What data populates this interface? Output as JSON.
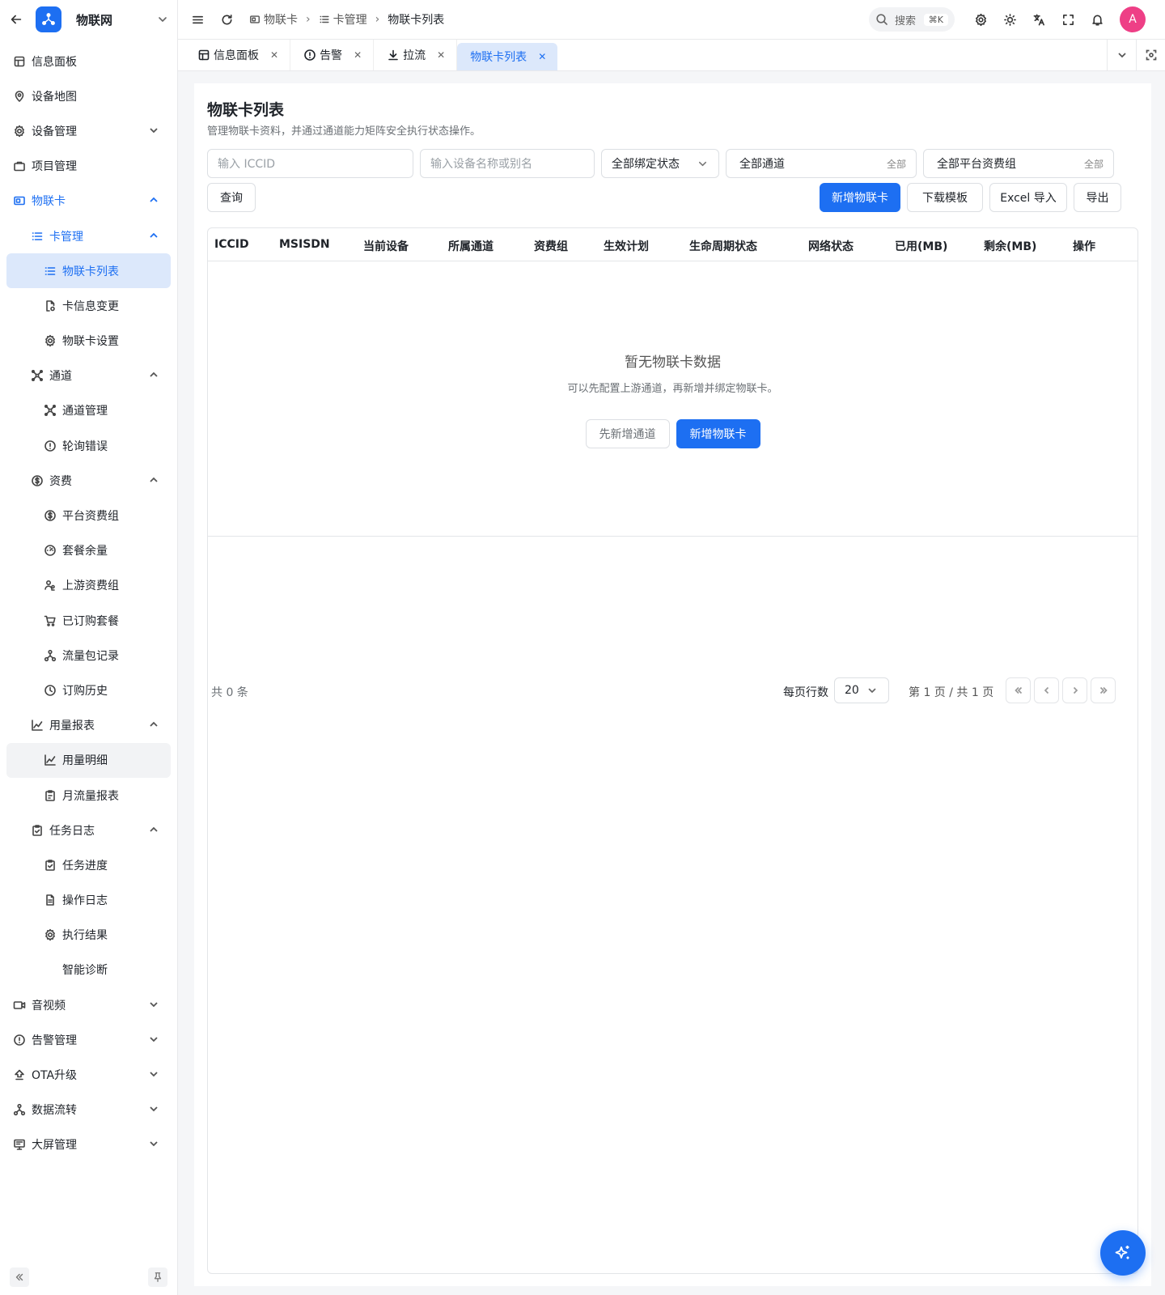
{
  "app": {
    "name": "物联网"
  },
  "sidebar": {
    "items": [
      {
        "key": "dashboard",
        "label": "信息面板",
        "icon": "dashboard-icon",
        "level": 0
      },
      {
        "key": "device-map",
        "label": "设备地图",
        "icon": "map-icon",
        "level": 0
      },
      {
        "key": "device-mgmt",
        "label": "设备管理",
        "icon": "gear-icon",
        "level": 0,
        "chevron": "down"
      },
      {
        "key": "project-mgmt",
        "label": "项目管理",
        "icon": "briefcase-icon",
        "level": 0
      },
      {
        "key": "iot-card",
        "label": "物联卡",
        "icon": "sim-card-icon",
        "level": 0,
        "chevron": "up",
        "state": "open-blue"
      },
      {
        "key": "card-mgmt",
        "label": "卡管理",
        "icon": "list-icon",
        "level": 1,
        "chevron": "up",
        "state": "open-blue"
      },
      {
        "key": "card-list",
        "label": "物联卡列表",
        "icon": "list-icon",
        "level": 2,
        "state": "active"
      },
      {
        "key": "card-change",
        "label": "卡信息变更",
        "icon": "file-edit-icon",
        "level": 2
      },
      {
        "key": "card-settings",
        "label": "物联卡设置",
        "icon": "gear-icon",
        "level": 2
      },
      {
        "key": "channel",
        "label": "通道",
        "icon": "channel-icon",
        "level": 1,
        "chevron": "up"
      },
      {
        "key": "channel-mgmt",
        "label": "通道管理",
        "icon": "channel-icon",
        "level": 2
      },
      {
        "key": "poll-errors",
        "label": "轮询错误",
        "icon": "alert-circle-icon",
        "level": 2
      },
      {
        "key": "tariff",
        "label": "资费",
        "icon": "dollar-circle-icon",
        "level": 1,
        "chevron": "up"
      },
      {
        "key": "platform-tariff",
        "label": "平台资费组",
        "icon": "dollar-circle-icon",
        "level": 2
      },
      {
        "key": "plan-balance",
        "label": "套餐余量",
        "icon": "gauge-icon",
        "level": 2
      },
      {
        "key": "upstream-tariff",
        "label": "上游资费组",
        "icon": "users-icon",
        "level": 2
      },
      {
        "key": "subscribed-plans",
        "label": "已订购套餐",
        "icon": "cart-icon",
        "level": 2
      },
      {
        "key": "traffic-records",
        "label": "流量包记录",
        "icon": "nodes-icon",
        "level": 2
      },
      {
        "key": "order-history",
        "label": "订购历史",
        "icon": "clock-icon",
        "level": 2
      },
      {
        "key": "usage-report",
        "label": "用量报表",
        "icon": "line-chart-icon",
        "level": 1,
        "chevron": "up"
      },
      {
        "key": "usage-detail",
        "label": "用量明细",
        "icon": "line-chart-icon",
        "level": 2,
        "state": "hover"
      },
      {
        "key": "monthly-report",
        "label": "月流量报表",
        "icon": "clipboard-icon",
        "level": 2
      },
      {
        "key": "task-log",
        "label": "任务日志",
        "icon": "clipboard-check-icon",
        "level": 1,
        "chevron": "up"
      },
      {
        "key": "task-progress",
        "label": "任务进度",
        "icon": "clipboard-check-icon",
        "level": 2
      },
      {
        "key": "operation-log",
        "label": "操作日志",
        "icon": "document-icon",
        "level": 2
      },
      {
        "key": "exec-result",
        "label": "执行结果",
        "icon": "gear-icon",
        "level": 2
      },
      {
        "key": "smart-diagnosis",
        "label": "智能诊断",
        "icon": "",
        "level": 2
      },
      {
        "key": "av",
        "label": "音视频",
        "icon": "video-icon",
        "level": 0,
        "chevron": "down"
      },
      {
        "key": "alarm-mgmt",
        "label": "告警管理",
        "icon": "alert-circle-icon",
        "level": 0,
        "chevron": "down"
      },
      {
        "key": "ota",
        "label": "OTA升级",
        "icon": "upload-icon",
        "level": 0,
        "chevron": "down"
      },
      {
        "key": "data-flow",
        "label": "数据流转",
        "icon": "nodes-icon",
        "level": 0,
        "chevron": "down"
      },
      {
        "key": "big-screen",
        "label": "大屏管理",
        "icon": "monitor-icon",
        "level": 0,
        "chevron": "down"
      }
    ]
  },
  "topbar": {
    "breadcrumb": [
      {
        "label": "物联卡",
        "icon": "sim-card-icon"
      },
      {
        "label": "卡管理",
        "icon": "list-icon"
      },
      {
        "label": "物联卡列表",
        "icon": ""
      }
    ],
    "search_label": "搜索",
    "search_shortcut": "⌘K",
    "avatar_letter": "A"
  },
  "tabs": [
    {
      "label": "信息面板",
      "icon": "dashboard-icon",
      "active": false
    },
    {
      "label": "告警",
      "icon": "alert-circle-icon",
      "active": false
    },
    {
      "label": "拉流",
      "icon": "download-icon",
      "active": false
    },
    {
      "label": "物联卡列表",
      "icon": "",
      "active": true
    }
  ],
  "page": {
    "title": "物联卡列表",
    "description": "管理物联卡资料，并通过通道能力矩阵安全执行状态操作。"
  },
  "filters": {
    "iccid_placeholder": "输入 ICCID",
    "device_placeholder": "输入设备名称或别名",
    "binding_status": "全部绑定状态",
    "channel": "全部通道",
    "channel_tail": "全部",
    "tariff_group": "全部平台资费组",
    "tariff_group_tail": "全部",
    "query_button": "查询"
  },
  "actions": {
    "add_card": "新增物联卡",
    "download_template": "下载模板",
    "excel_import": "Excel 导入",
    "export": "导出"
  },
  "table": {
    "columns": [
      "ICCID",
      "MSISDN",
      "当前设备",
      "所属通道",
      "资费组",
      "生效计划",
      "生命周期状态",
      "网络状态",
      "已用(MB)",
      "剩余(MB)",
      "操作"
    ],
    "empty_title": "暂无物联卡数据",
    "empty_desc": "可以先配置上游通道，再新增并绑定物联卡。",
    "empty_add_channel": "先新增通道",
    "empty_add_card": "新增物联卡"
  },
  "pagination": {
    "total": "共 0 条",
    "rows_per_page_label": "每页行数",
    "page_size": "20",
    "page_info": "第 1 页 / 共 1 页"
  },
  "colors": {
    "primary": "#1d6ff2",
    "avatar": "#ee3f86",
    "active_bg": "#dce8fb"
  }
}
